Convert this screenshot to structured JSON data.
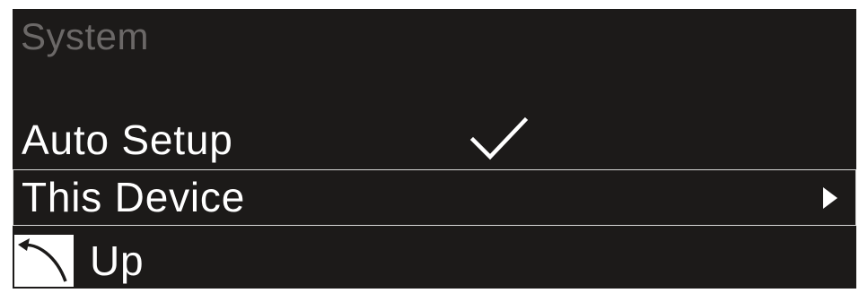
{
  "screen": {
    "title": "System",
    "menu": {
      "auto_setup": {
        "label": "Auto Setup",
        "selected_icon": "check-icon"
      },
      "this_device": {
        "label": "This Device",
        "submenu_icon": "triangle-right-icon",
        "highlighted": true
      },
      "up": {
        "label": "Up",
        "icon": "back-arrow-icon"
      }
    }
  },
  "colors": {
    "background": "#1c1a19",
    "text": "#ffffff",
    "title_text": "#6b6867",
    "highlight_border": "#d9d9d9"
  }
}
